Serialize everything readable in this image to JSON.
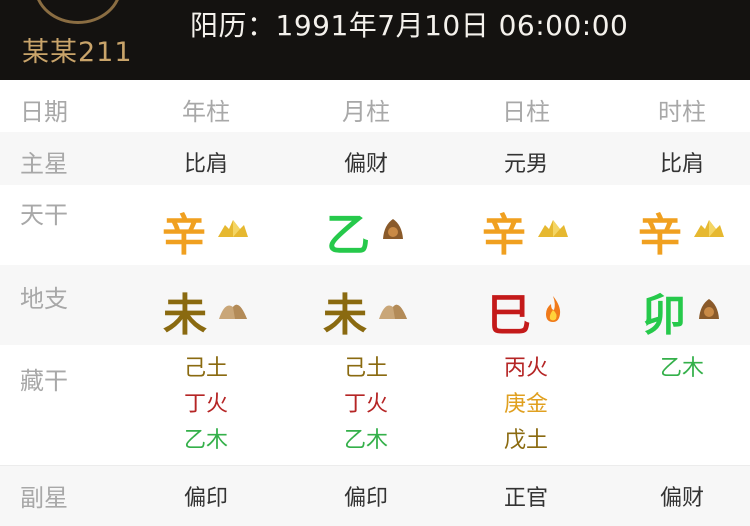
{
  "header": {
    "username": "某某211",
    "solar_date": "阳历：1991年7月10日  06:00:00"
  },
  "table": {
    "columns": [
      "日期",
      "年柱",
      "月柱",
      "日柱",
      "时柱"
    ],
    "main_star": {
      "label": "主星",
      "values": [
        "比肩",
        "偏财",
        "元男",
        "比肩"
      ]
    },
    "heavenly_stem": {
      "label": "天干",
      "values": [
        {
          "char": "辛",
          "color": "#f0a020",
          "icon": "metal-ingot-icon"
        },
        {
          "char": "乙",
          "color": "#26c94b",
          "icon": "wood-icon"
        },
        {
          "char": "辛",
          "color": "#f0a020",
          "icon": "metal-ingot-icon"
        },
        {
          "char": "辛",
          "color": "#f0a020",
          "icon": "metal-ingot-icon"
        }
      ]
    },
    "earthly_branch": {
      "label": "地支",
      "values": [
        {
          "char": "未",
          "color": "#8a6a10",
          "icon": "earth-mound-icon"
        },
        {
          "char": "未",
          "color": "#8a6a10",
          "icon": "earth-mound-icon"
        },
        {
          "char": "巳",
          "color": "#c41a1a",
          "icon": "fire-icon"
        },
        {
          "char": "卯",
          "color": "#26c94b",
          "icon": "wood-icon"
        }
      ]
    },
    "hidden_stems": {
      "label": "藏干",
      "values": [
        [
          {
            "text": "己土",
            "color": "#8a6a10"
          },
          {
            "text": "丁火",
            "color": "#b52525"
          },
          {
            "text": "乙木",
            "color": "#34b04a"
          }
        ],
        [
          {
            "text": "己土",
            "color": "#8a6a10"
          },
          {
            "text": "丁火",
            "color": "#b52525"
          },
          {
            "text": "乙木",
            "color": "#34b04a"
          }
        ],
        [
          {
            "text": "丙火",
            "color": "#b52525"
          },
          {
            "text": "庚金",
            "color": "#e0a020"
          },
          {
            "text": "戊土",
            "color": "#8a6a10"
          }
        ],
        [
          {
            "text": "乙木",
            "color": "#34b04a"
          }
        ]
      ]
    },
    "sub_star": {
      "label": "副星",
      "values": [
        "偏印",
        "偏印",
        "正官",
        "偏财"
      ]
    }
  }
}
